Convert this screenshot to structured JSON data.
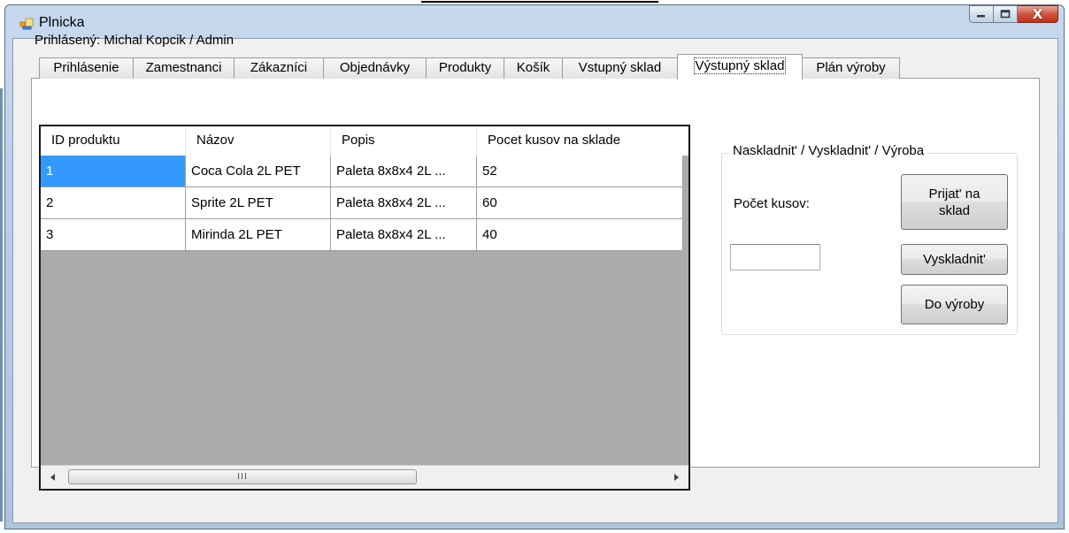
{
  "window": {
    "title": "Plnicka",
    "minimize_glyph": "–",
    "maximize_glyph": "▭",
    "close_glyph": "X"
  },
  "user_label": "Prihlásený: Michal Kopcik / Admin",
  "tabs": [
    {
      "label": "Prihlásenie"
    },
    {
      "label": "Zamestnanci"
    },
    {
      "label": "Zákazníci"
    },
    {
      "label": "Objednávky"
    },
    {
      "label": "Produkty"
    },
    {
      "label": "Košík"
    },
    {
      "label": "Vstupný sklad"
    },
    {
      "label": "Výstupný sklad",
      "active": true
    },
    {
      "label": "Plán výroby"
    }
  ],
  "grid": {
    "columns": [
      "ID produktu",
      "Názov",
      "Popis",
      "Pocet kusov na sklade"
    ],
    "rows": [
      [
        "1",
        "Coca Cola 2L PET",
        "Paleta 8x8x4 2L ...",
        "52"
      ],
      [
        "2",
        "Sprite 2L PET",
        "Paleta 8x8x4 2L ...",
        "60"
      ],
      [
        "3",
        "Mirinda 2L PET",
        "Paleta 8x8x4 2L ...",
        "40"
      ]
    ],
    "selected_row": 0,
    "scroll_grip": "III"
  },
  "group": {
    "title": "Naskladnit' / Vyskladnit' / Výroba",
    "pocet_label": "Počet kusov:",
    "qty_value": "",
    "btn_prijat_line1": "Prijat' na",
    "btn_prijat_line2": "sklad",
    "btn_vyskladnit": "Vyskladnit'",
    "btn_vyroba": "Do výroby"
  },
  "colors": {
    "selection": "#3399ff",
    "grid_background": "#ababab",
    "close_button": "#c2321b"
  }
}
